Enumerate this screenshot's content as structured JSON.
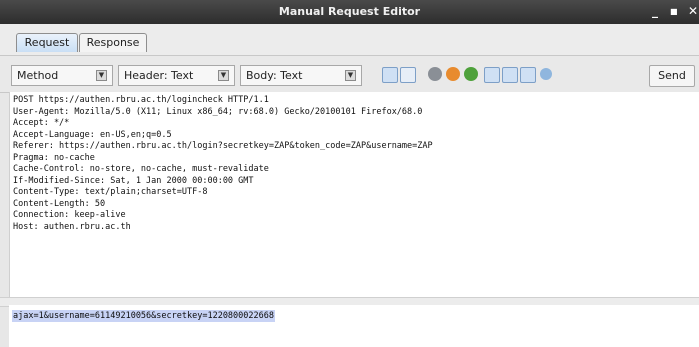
{
  "window": {
    "title": "Manual Request Editor",
    "minimize_glyph": "_",
    "maximize_glyph": "■",
    "close_glyph": "✕"
  },
  "tabs": [
    {
      "label": "Request",
      "active": true
    },
    {
      "label": "Response",
      "active": false
    }
  ],
  "toolbar": {
    "method_label": "Method",
    "header_select": "Header: Text",
    "body_select": "Body: Text",
    "send_label": "Send",
    "icons": [
      "layout-split-icon",
      "layout-tab-icon",
      "gray-dot-icon",
      "orange-swirl-icon",
      "green-bubble-icon",
      "layout-side-icon",
      "layout-bottom-icon",
      "layout-full-icon",
      "help-icon"
    ]
  },
  "request": {
    "header": "POST https://authen.rbru.ac.th/logincheck HTTP/1.1\nUser-Agent: Mozilla/5.0 (X11; Linux x86_64; rv:68.0) Gecko/20100101 Firefox/68.0\nAccept: */*\nAccept-Language: en-US,en;q=0.5\nReferer: https://authen.rbru.ac.th/login?secretkey=ZAP&token_code=ZAP&username=ZAP\nPragma: no-cache\nCache-Control: no-store, no-cache, must-revalidate\nIf-Modified-Since: Sat, 1 Jan 2000 00:00:00 GMT\nContent-Type: text/plain;charset=UTF-8\nContent-Length: 50\nConnection: keep-alive\nHost: authen.rbru.ac.th",
    "body": "ajax=1&username=61149210056&secretkey=1220800022668"
  },
  "colors": {
    "titlebar": "#333333",
    "body_selection": "#c8d3f5",
    "active_tab": "#c9dff5"
  }
}
